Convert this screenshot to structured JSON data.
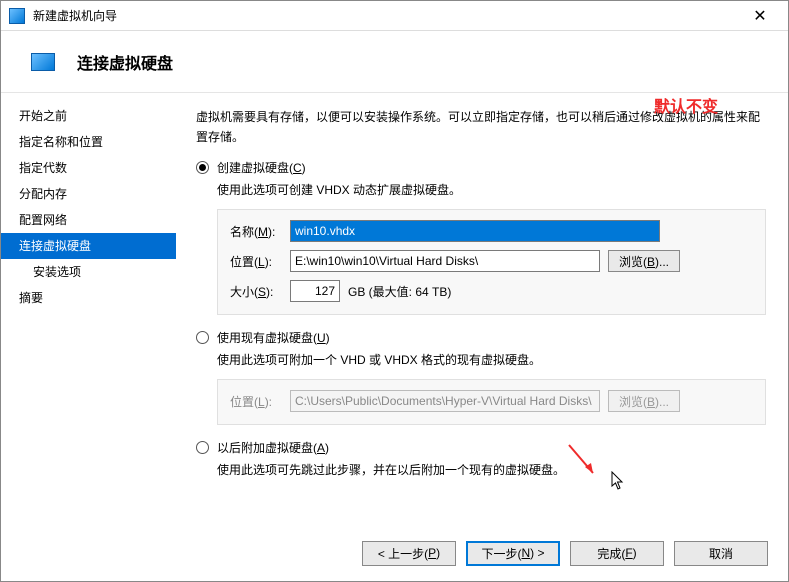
{
  "titlebar": {
    "title": "新建虚拟机向导"
  },
  "header": {
    "title": "连接虚拟硬盘"
  },
  "sidebar": {
    "items": [
      {
        "label": "开始之前"
      },
      {
        "label": "指定名称和位置"
      },
      {
        "label": "指定代数"
      },
      {
        "label": "分配内存"
      },
      {
        "label": "配置网络"
      },
      {
        "label": "连接虚拟硬盘"
      },
      {
        "label": "安装选项"
      },
      {
        "label": "摘要"
      }
    ]
  },
  "content": {
    "intro": "虚拟机需要具有存储，以便可以安装操作系统。可以立即指定存储，也可以稍后通过修改虚拟机的属性来配置存储。",
    "opt1": {
      "label_pre": "创建虚拟硬盘(",
      "label_key": "C",
      "label_post": ")",
      "desc": "使用此选项可创建 VHDX 动态扩展虚拟硬盘。",
      "name_label_pre": "名称(",
      "name_label_key": "M",
      "name_label_post": "):",
      "name_value": "win10.vhdx",
      "loc_label_pre": "位置(",
      "loc_label_key": "L",
      "loc_label_post": "):",
      "loc_value": "E:\\win10\\win10\\Virtual Hard Disks\\",
      "browse_pre": "浏览(",
      "browse_key": "B",
      "browse_post": ")...",
      "size_label_pre": "大小(",
      "size_label_key": "S",
      "size_label_post": "):",
      "size_value": "127",
      "size_suffix": "GB (最大值: 64 TB)"
    },
    "opt2": {
      "label_pre": "使用现有虚拟硬盘(",
      "label_key": "U",
      "label_post": ")",
      "desc": "使用此选项可附加一个 VHD 或 VHDX 格式的现有虚拟硬盘。",
      "loc_label_pre": "位置(",
      "loc_label_key": "L",
      "loc_label_post": "):",
      "loc_value": "C:\\Users\\Public\\Documents\\Hyper-V\\Virtual Hard Disks\\",
      "browse_pre": "浏览(",
      "browse_key": "B",
      "browse_post": ")..."
    },
    "opt3": {
      "label_pre": "以后附加虚拟硬盘(",
      "label_key": "A",
      "label_post": ")",
      "desc": "使用此选项可先跳过此步骤，并在以后附加一个现有的虚拟硬盘。"
    },
    "annotation": "默认不变"
  },
  "footer": {
    "prev_pre": "< 上一步(",
    "prev_key": "P",
    "prev_post": ")",
    "next_pre": "下一步(",
    "next_key": "N",
    "next_post": ") >",
    "finish_pre": "完成(",
    "finish_key": "F",
    "finish_post": ")",
    "cancel": "取消"
  }
}
